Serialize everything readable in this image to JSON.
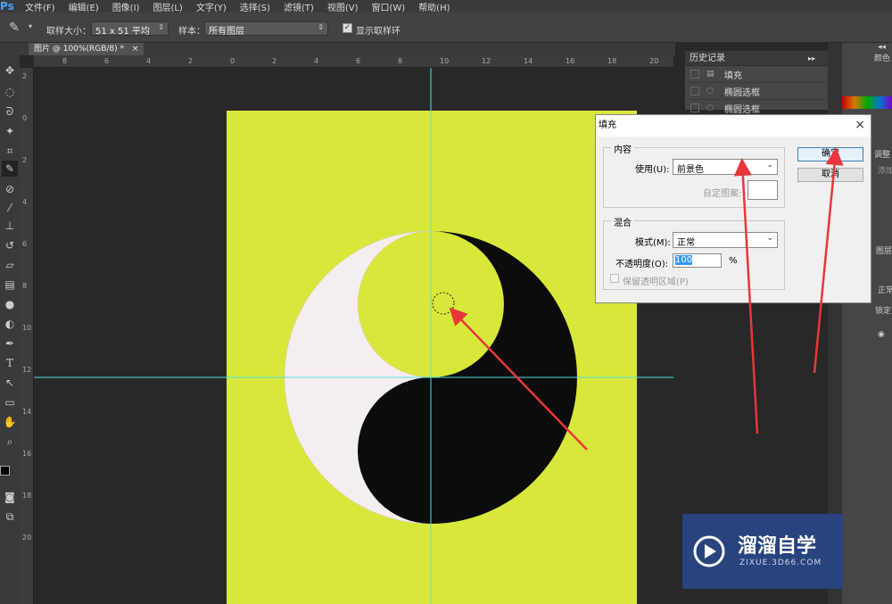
{
  "app": {
    "logo": "Ps"
  },
  "menu": [
    "文件(F)",
    "编辑(E)",
    "图像(I)",
    "图层(L)",
    "文字(Y)",
    "选择(S)",
    "滤镜(T)",
    "视图(V)",
    "窗口(W)",
    "帮助(H)"
  ],
  "options": {
    "sample_size_label": "取样大小：",
    "sample_size_value": "51 x 51 平均",
    "sample_label": "样本：",
    "sample_value": "所有图层",
    "show_ring_label": "显示取样环"
  },
  "document": {
    "tab_title": "图片 @ 100%(RGB/8) *",
    "tab_close": "×",
    "canvas_color": "#d8e83a",
    "guide_color": "#4fe0e0"
  },
  "ruler": {
    "h_ticks": [
      "8",
      "6",
      "4",
      "2",
      "0",
      "2",
      "4",
      "6",
      "8",
      "10",
      "12",
      "14",
      "16",
      "18",
      "20"
    ],
    "v_ticks": [
      "2",
      "0",
      "2",
      "4",
      "6",
      "8",
      "10",
      "12",
      "14",
      "16",
      "18",
      "20"
    ]
  },
  "history": {
    "title": "历史记录",
    "items": [
      {
        "label": "填充",
        "icon": "fill-icon"
      },
      {
        "label": "椭圆选框",
        "icon": "ellipse-marquee-icon"
      },
      {
        "label": "椭圆选框",
        "icon": "ellipse-marquee-icon"
      }
    ]
  },
  "right_panel": {
    "color_label": "颜色",
    "adjust_label": "调整",
    "add_label": "添加",
    "layers_label": "图层",
    "normal_label": "正常",
    "lock_label": "锁定"
  },
  "dialog": {
    "title": "填充",
    "close": "×",
    "content_group": "内容",
    "use_label": "使用(U):",
    "use_value": "前景色",
    "custom_pattern_label": "自定图案:",
    "blend_group": "混合",
    "mode_label": "模式(M):",
    "mode_value": "正常",
    "opacity_label": "不透明度(O):",
    "opacity_value": "100",
    "opacity_unit": "%",
    "preserve_label": "保留透明区域(P)",
    "ok": "确定",
    "cancel": "取消"
  },
  "watermark": {
    "brand": "溜溜自学",
    "url": "ZIXUE.3D66.COM"
  },
  "colors": {
    "arrow": "#e8363a",
    "watermark_bg": "#28437e"
  }
}
